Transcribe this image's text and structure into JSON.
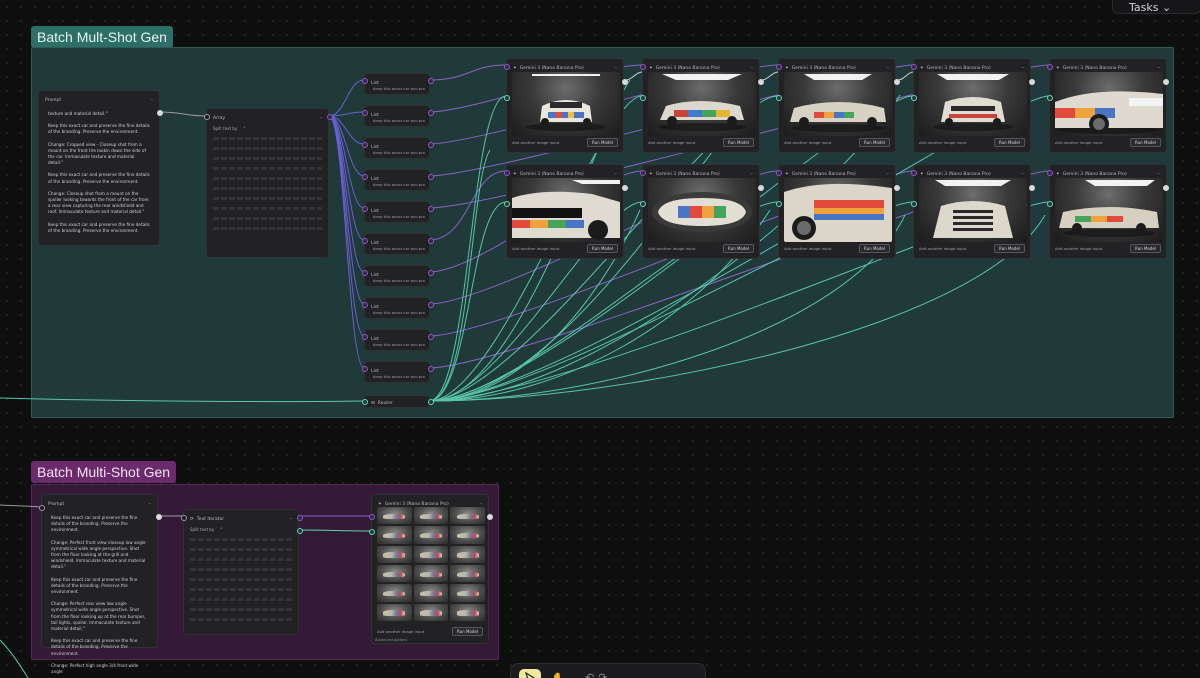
{
  "header": {
    "tasks_label": "Tasks"
  },
  "groups": {
    "top": {
      "title": "Batch Mult-Shot Gen",
      "color": "#2b6f67"
    },
    "bottom": {
      "title": "Batch Multi-Shot Gen",
      "color": "#6a2a6c"
    }
  },
  "top_prompt": {
    "title": "Prompt",
    "paragraphs": [
      "texture and material detail.\"",
      "Keep this exact car and preserve the fine details of the branding. Preserve the environment.",
      "Change: Cropped view - Closeup shot from a mount on the front tire lookin down the side of the car. Immaculate texture and material detail.\"",
      "Keep this exact car and preserve the fine details of the branding. Preserve the environment.",
      "Change: Closeup shot from a mount on the spoiler looking towards the front of the car from a rear view capturing the rear windshield and roof. Immaculate texture and material detail.\"",
      "Keep this exact car and preserve the fine details of the branding. Preserve the environment."
    ]
  },
  "array_node": {
    "title": "Array",
    "split_label": "Split text by",
    "split_value": "\""
  },
  "list_node": {
    "title": "List",
    "preview": "Keep this exact car and preserv..."
  },
  "router": {
    "title": "Router"
  },
  "gemini_node": {
    "title": "Gemini 3 (Nano Banana Pro)",
    "add_input": "Add another image input",
    "run": "Run Model"
  },
  "bottom_prompt": {
    "title": "Prompt",
    "paragraphs": [
      "Keep this exact car and preserve the fine details of the branding. Preserve the environment.",
      "Change: Perfect front view closeup low angle symmetrical wide angle perspective. Shot from the floor looking at the grill and windshield. Immaculate texture and material detail.\"",
      "Keep this exact car and preserve the fine details of the branding. Preserve the environment.",
      "Change: Perfect rear view low angle symmetrical wide angle perspective. Shot from the floor looking up at the rear bumper, tail lights, spoiler. Immaculate texture and material detail.\"",
      "Keep this exact car and preserve the fine details of the branding. Preserve the environment.",
      "Change: Perfect high angle 3/4 front wide angle"
    ]
  },
  "text_iterator": {
    "title": "Text Iterator",
    "split_label": "Split text by",
    "split_value": "\""
  },
  "bottom_gemini": {
    "title": "Gemini 3 (Nano Banana Pro)",
    "add_input": "Add another image input",
    "run": "Run Model",
    "advanced": "Advanced options"
  }
}
